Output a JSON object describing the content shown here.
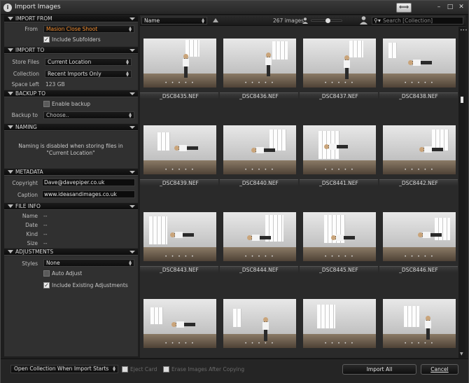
{
  "window": {
    "title": "Import Images",
    "app_icon": "i",
    "swap_icon": "⟺",
    "min_icon": "–",
    "max_icon": "□",
    "close_icon": "✕"
  },
  "import_from": {
    "header": "IMPORT FROM",
    "from_label": "From",
    "from_value": "Masion Close Shoot",
    "include_subfolders": "Include Subfolders",
    "include_subfolders_checked": true
  },
  "import_to": {
    "header": "IMPORT TO",
    "store_files_label": "Store Files",
    "store_files_value": "Current Location",
    "collection_label": "Collection",
    "collection_value": "Recent Imports Only",
    "space_left_label": "Space Left",
    "space_left_value": "123 GB"
  },
  "backup_to": {
    "header": "BACKUP TO",
    "enable_backup": "Enable backup",
    "backup_to_label": "Backup to",
    "backup_to_value": "Choose.."
  },
  "naming": {
    "header": "NAMING",
    "note_line1": "Naming is disabled when storing files in",
    "note_line2": "\"Current Location\""
  },
  "metadata": {
    "header": "METADATA",
    "copyright_label": "Copyright",
    "copyright_value": "Dave@davepiper.co.uk",
    "caption_label": "Caption",
    "caption_value": "www.ideasandimages.co.uk"
  },
  "file_info": {
    "header": "FILE INFO",
    "rows": [
      {
        "label": "Name",
        "value": "--"
      },
      {
        "label": "Date",
        "value": "--"
      },
      {
        "label": "Kind",
        "value": "--"
      },
      {
        "label": "Size",
        "value": "--"
      }
    ]
  },
  "adjustments": {
    "header": "ADJUSTMENTS",
    "styles_label": "Styles",
    "styles_value": "None",
    "auto_adjust": "Auto Adjust",
    "include_existing": "Include Existing Adjustments",
    "include_existing_checked": true
  },
  "browser": {
    "sort_value": "Name",
    "image_count": "267 images",
    "search_placeholder": "Search [Collection]",
    "thumb_size_level": 0.52,
    "dots": "• • • • •",
    "images": [
      {
        "name": "_DSC8435.NEF"
      },
      {
        "name": "_DSC8436.NEF"
      },
      {
        "name": "_DSC8437.NEF"
      },
      {
        "name": "_DSC8438.NEF"
      },
      {
        "name": "_DSC8439.NEF"
      },
      {
        "name": "_DSC8440.NEF"
      },
      {
        "name": "_DSC8441.NEF"
      },
      {
        "name": "_DSC8442.NEF"
      },
      {
        "name": "_DSC8443.NEF"
      },
      {
        "name": "_DSC8444.NEF"
      },
      {
        "name": "_DSC8445.NEF"
      },
      {
        "name": "_DSC8446.NEF"
      },
      {
        "name": ""
      },
      {
        "name": ""
      },
      {
        "name": ""
      },
      {
        "name": ""
      }
    ]
  },
  "footer": {
    "open_collection": "Open Collection When Import Starts",
    "eject_card": "Eject Card",
    "erase_images": "Erase Images After Copying",
    "import_all": "Import All",
    "cancel": "Cancel"
  },
  "colors": {
    "accent_from": "#f08a2c",
    "panel_bg": "#303030",
    "header_bg": "#111111"
  }
}
